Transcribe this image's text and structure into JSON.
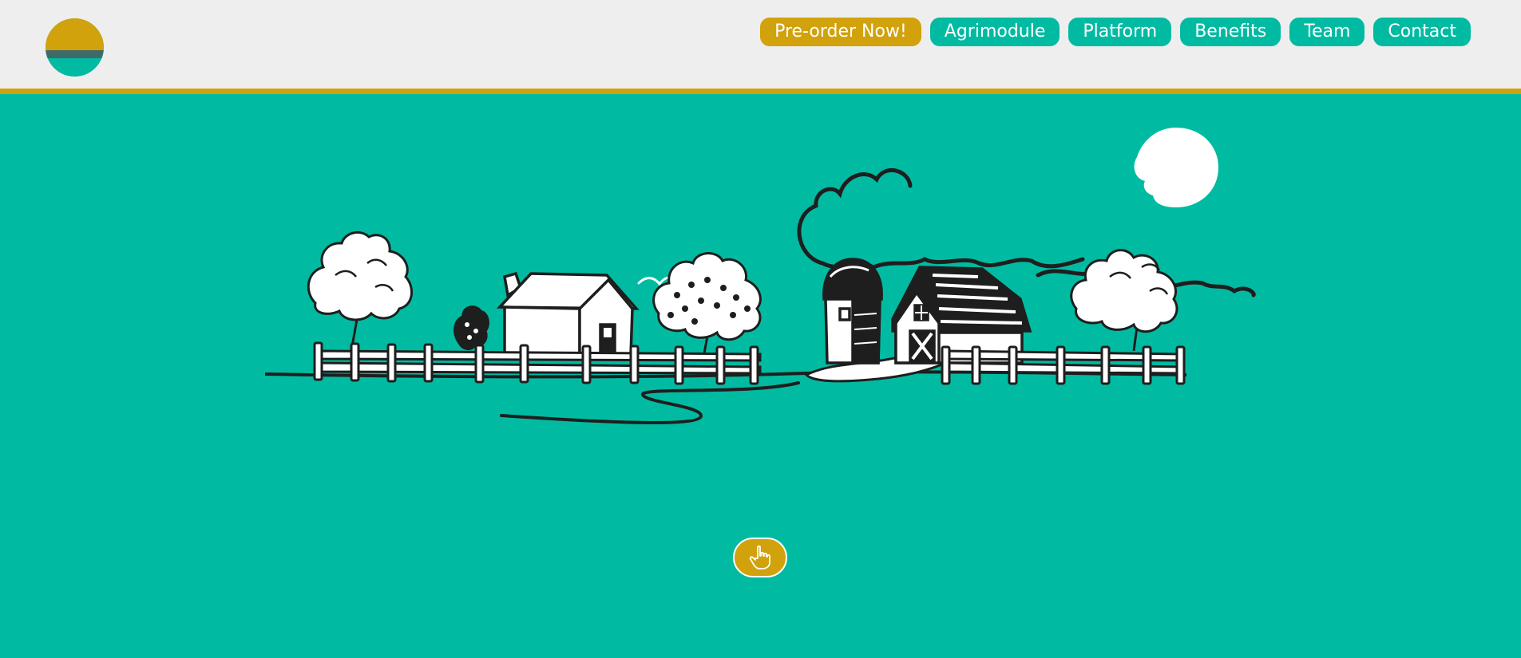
{
  "header": {
    "logo_name": "sun-logo",
    "nav": [
      {
        "label": "Pre-order Now!",
        "primary": true
      },
      {
        "label": "Agrimodule"
      },
      {
        "label": "Platform"
      },
      {
        "label": "Benefits"
      },
      {
        "label": "Team"
      },
      {
        "label": "Contact"
      }
    ]
  },
  "hero": {
    "illustration": "farm-landscape",
    "cta_icon": "pointing-hand-icon"
  },
  "colors": {
    "teal": "#00bba2",
    "gold": "#d1a20b",
    "header_bg": "#eeeeee",
    "logo_stripe": "#3e6b6a",
    "ink": "#1e1e1e"
  }
}
